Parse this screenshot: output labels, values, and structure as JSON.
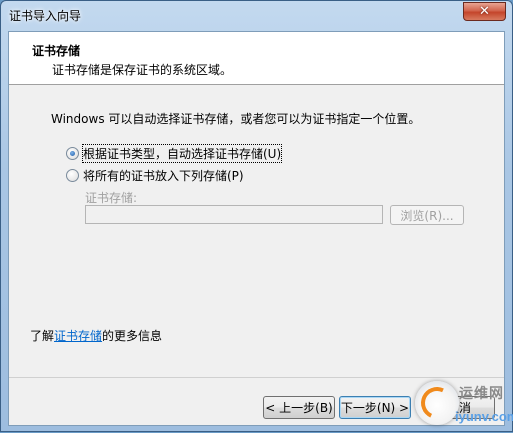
{
  "window": {
    "title": "证书导入向导",
    "close_glyph": "✕"
  },
  "header": {
    "title": "证书存储",
    "subtitle": "证书存储是保存证书的系统区域。"
  },
  "main": {
    "description": "Windows 可以自动选择证书存储，或者您可以为证书指定一个位置。",
    "options": [
      {
        "label": "根据证书类型，自动选择证书存储(U)",
        "checked": true
      },
      {
        "label": "将所有的证书放入下列存储(P)",
        "checked": false
      }
    ],
    "store_label": "证书存储:",
    "store_value": "",
    "browse_label": "浏览(R)...",
    "learn_prefix": "了解",
    "learn_link": "证书存储",
    "learn_suffix": "的更多信息"
  },
  "footer": {
    "back_label": "< 上一步(B)",
    "next_label": "下一步(N) >",
    "cancel_label": "取消"
  },
  "watermark": {
    "text": "运维网",
    "url": "iyunv.com"
  },
  "colors": {
    "link": "#0066cc",
    "title_bar": "#a9c6e4",
    "close_button": "#c4452b"
  }
}
